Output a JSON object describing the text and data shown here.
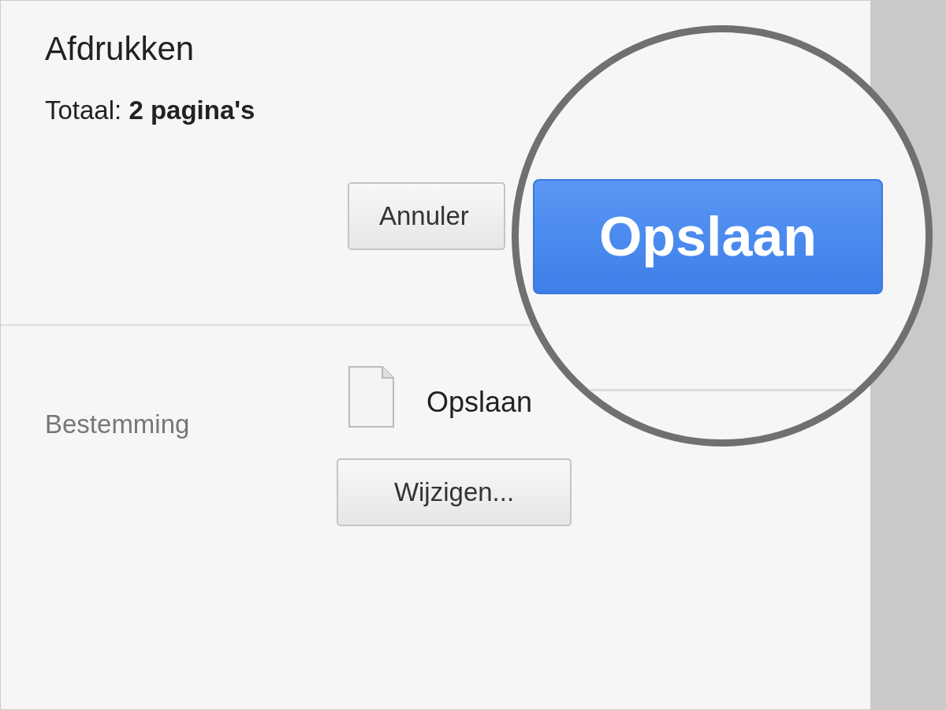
{
  "title": "Afdrukken",
  "summary": "Totaal: **2 pagina's**",
  "cancel_button": "Annuler",
  "destination": {
    "label": "Bestemming",
    "value": "Opslaan",
    "change_button": "Wijzigen..."
  },
  "magnifier": {
    "button": "Opslaan"
  }
}
